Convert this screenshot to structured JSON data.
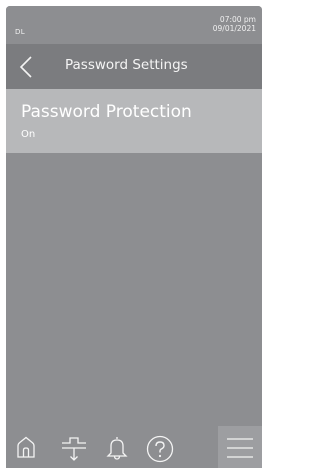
{
  "status_bar": {
    "device_id": "DL",
    "time": "07:00 pm",
    "date": "09/01/2021"
  },
  "header": {
    "back_icon": "chevron-left-icon",
    "title": "Password Settings"
  },
  "settings": [
    {
      "label": "Password Protection",
      "value": "On"
    }
  ],
  "bottom_nav": {
    "items": [
      "home-icon",
      "drain-icon",
      "bell-icon",
      "help-icon",
      "menu-icon"
    ]
  },
  "colors": {
    "background": "#8d8e91",
    "header": "#7b7c7f",
    "selected_row": "#b7b8ba",
    "text": "#ffffff"
  }
}
